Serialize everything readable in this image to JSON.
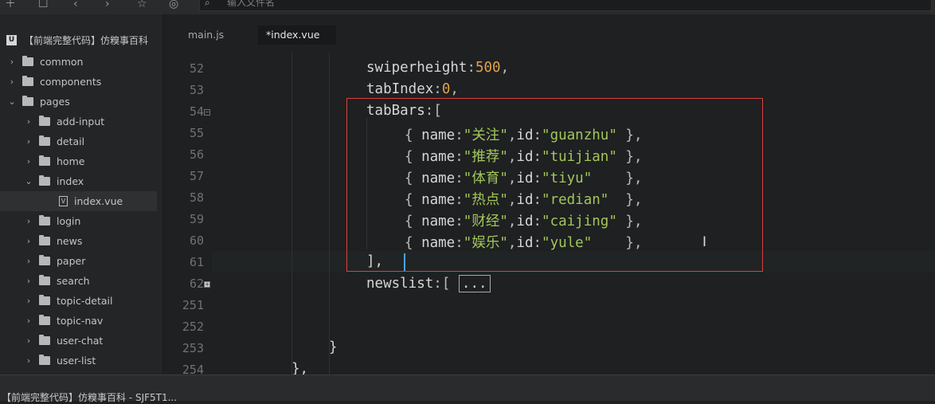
{
  "toolbar": {
    "search_placeholder": "输入文件名",
    "icons": [
      "new-file-icon",
      "square-icon",
      "back-icon",
      "forward-icon",
      "star-icon",
      "run-icon",
      "search-icon"
    ]
  },
  "sidebar": {
    "project_logo": "U",
    "project_name": "【前端完整代码】仿糗事百科",
    "items": [
      {
        "label": "common"
      },
      {
        "label": "components"
      },
      {
        "label": "pages"
      },
      {
        "label": "add-input"
      },
      {
        "label": "detail"
      },
      {
        "label": "home"
      },
      {
        "label": "index"
      },
      {
        "label": "index.vue"
      },
      {
        "label": "login"
      },
      {
        "label": "news"
      },
      {
        "label": "paper"
      },
      {
        "label": "search"
      },
      {
        "label": "topic-detail"
      },
      {
        "label": "topic-nav"
      },
      {
        "label": "user-chat"
      },
      {
        "label": "user-list"
      }
    ]
  },
  "tabs": [
    {
      "label": "main.js"
    },
    {
      "label": "*index.vue"
    }
  ],
  "editor": {
    "line_numbers": [
      "52",
      "53",
      "54",
      "55",
      "56",
      "57",
      "58",
      "59",
      "60",
      "61",
      "62",
      "251",
      "252",
      "253",
      "254"
    ],
    "lines": {
      "l52_key": "swiperheight",
      "l52_val": "500",
      "l53_key": "tabIndex",
      "l53_val": "0",
      "l54_key": "tabBars",
      "tab_items": [
        {
          "name": "\"关注\"",
          "id": "\"guanzhu\"",
          "pad": " "
        },
        {
          "name": "\"推荐\"",
          "id": "\"tuijian\"",
          "pad": " "
        },
        {
          "name": "\"体育\"",
          "id": "\"tiyu\"",
          "pad": "    "
        },
        {
          "name": "\"热点\"",
          "id": "\"redian\"",
          "pad": "  "
        },
        {
          "name": "\"财经\"",
          "id": "\"caijing\"",
          "pad": " "
        },
        {
          "name": "\"娱乐\"",
          "id": "\"yule\"",
          "pad": "    "
        }
      ],
      "l61": "],",
      "l62_key": "newslist",
      "l62_collapsed": "...",
      "l253": "}",
      "l254": "},"
    }
  },
  "status": {
    "title": "【前端完整代码】仿糗事百科 - SJF5T1..."
  }
}
